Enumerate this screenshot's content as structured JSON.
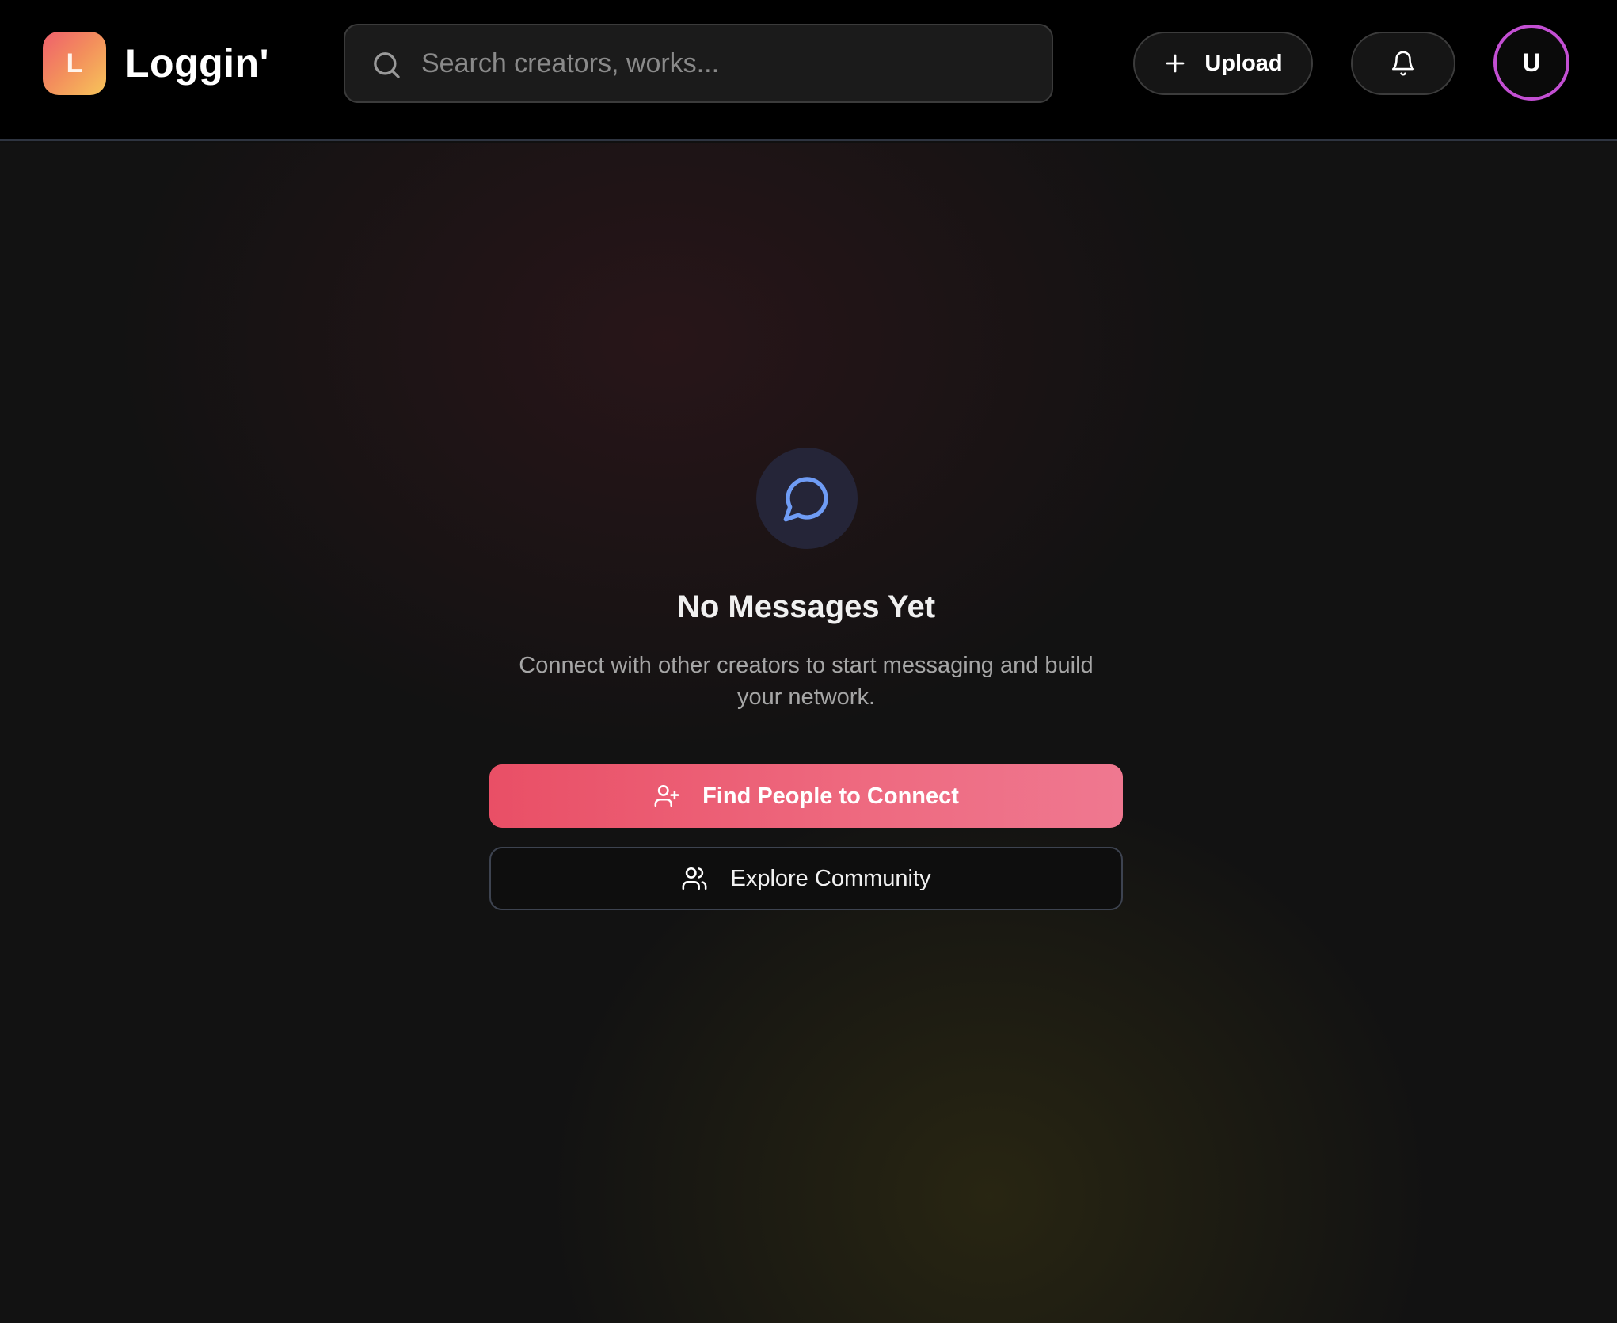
{
  "header": {
    "logo_letter": "L",
    "app_title": "Loggin'",
    "search": {
      "placeholder": "Search creators, works...",
      "value": ""
    },
    "upload_label": "Upload",
    "avatar_initial": "U"
  },
  "empty_state": {
    "title": "No Messages Yet",
    "description": "Connect with other creators to start messaging and build your network.",
    "primary_action": "Find People to Connect",
    "secondary_action": "Explore Community"
  },
  "icons": {
    "search": "search-icon",
    "upload": "plus-icon",
    "notifications": "bell-icon",
    "empty_state": "message-circle-icon",
    "primary_action": "user-plus-icon",
    "secondary_action": "users-icon"
  },
  "colors": {
    "header_background": "#000000",
    "page_background": "#121212",
    "logo_gradient_start": "#ef5f6c",
    "logo_gradient_end": "#f7c55a",
    "primary_gradient_start": "#e94f66",
    "primary_gradient_end": "#ef7890",
    "avatar_ring": "#c34fd3",
    "chat_icon": "#6f9cf5",
    "chat_icon_bg": "#252538"
  }
}
